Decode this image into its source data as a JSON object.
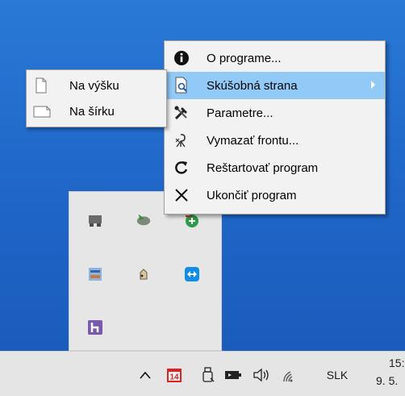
{
  "menu": {
    "items": [
      {
        "label": "O programe...",
        "icon": "info-icon"
      },
      {
        "label": "Skúšobná strana",
        "icon": "print-preview-icon",
        "has_submenu": true,
        "highlighted": true
      },
      {
        "label": "Parametre...",
        "icon": "tools-icon"
      },
      {
        "label": "Vymazať frontu...",
        "icon": "clear-queue-icon"
      },
      {
        "label": "Reštartovať program",
        "icon": "restart-icon"
      },
      {
        "label": "Ukončiť program",
        "icon": "close-icon"
      }
    ]
  },
  "submenu": {
    "items": [
      {
        "label": "Na výšku",
        "icon": "portrait-page-icon"
      },
      {
        "label": "Na šírku",
        "icon": "landscape-page-icon"
      }
    ]
  },
  "tray_flyout": {
    "icons": [
      "printer-icon",
      "leaf-app-icon",
      "shield-icon",
      "network-card-icon",
      "hand-cursor-icon",
      "teamviewer-icon",
      "h-app-icon"
    ]
  },
  "taskbar": {
    "calendar_badge": "14",
    "language": "SLK",
    "clock_time": "15:",
    "clock_date": "9. 5."
  },
  "colors": {
    "desktop": "#1f66c8",
    "menu_highlight": "#91c9f7",
    "taskbar": "#e5e5e5",
    "calendar_red": "#e02020"
  }
}
